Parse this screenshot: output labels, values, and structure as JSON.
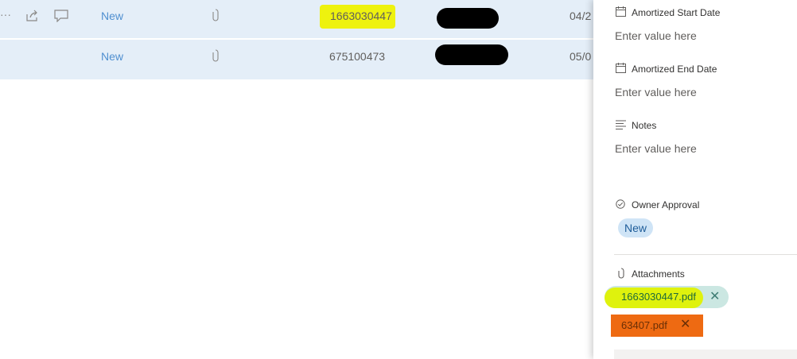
{
  "rows": [
    {
      "status": "New",
      "number": "1663030447",
      "date": "04/2"
    },
    {
      "status": "New",
      "number": "675100473",
      "date": "05/0"
    }
  ],
  "panel": {
    "fields": [
      {
        "label": "Amortized Start Date",
        "placeholder": "Enter value here",
        "icon": "calendar-icon"
      },
      {
        "label": "Amortized End Date",
        "placeholder": "Enter value here",
        "icon": "calendar-icon"
      },
      {
        "label": "Notes",
        "placeholder": "Enter value here",
        "icon": "notes-icon"
      }
    ],
    "owner_approval": {
      "label": "Owner Approval",
      "value": "New"
    },
    "attachments": {
      "label": "Attachments",
      "files": [
        "1663030447.pdf",
        "63407.pdf"
      ]
    }
  },
  "colors": {
    "row_bg": "#e4eef8",
    "status_link": "#4f8fd0",
    "highlight_yellow": "#eef20e",
    "highlight_orange": "#ee6a12"
  }
}
